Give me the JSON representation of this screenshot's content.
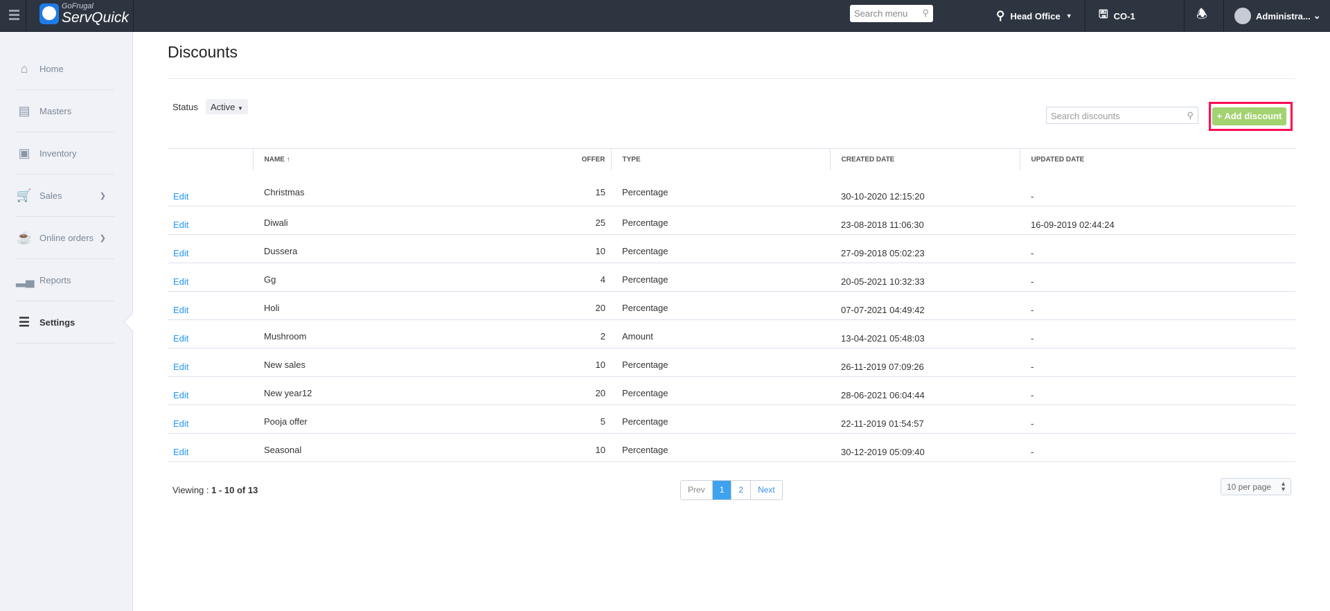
{
  "topbar": {
    "brand_small": "GoFrugal",
    "brand": "ServQuick",
    "search_placeholder": "Search menu",
    "location": "Head Office",
    "counter": "CO-1",
    "user": "Administra..."
  },
  "sidebar": {
    "items": [
      {
        "label": "Home",
        "icon": "home-icon"
      },
      {
        "label": "Masters",
        "icon": "masters-icon"
      },
      {
        "label": "Inventory",
        "icon": "inventory-icon"
      },
      {
        "label": "Sales",
        "icon": "cart-icon"
      },
      {
        "label": "Online orders",
        "icon": "online-orders-icon"
      },
      {
        "label": "Reports",
        "icon": "reports-icon"
      },
      {
        "label": "Settings",
        "icon": "settings-icon"
      }
    ]
  },
  "page": {
    "title": "Discounts",
    "status_label": "Status",
    "status_value": "Active",
    "search_placeholder": "Search discounts",
    "add_label": "+ Add discount"
  },
  "table": {
    "headers": {
      "name": "NAME",
      "offer": "OFFER",
      "type": "TYPE",
      "created": "CREATED DATE",
      "updated": "UPDATED DATE"
    },
    "edit_label": "Edit",
    "rows": [
      {
        "name": "Christmas",
        "offer": "15",
        "type": "Percentage",
        "created": "30-10-2020 12:15:20",
        "updated": "-"
      },
      {
        "name": "Diwali",
        "offer": "25",
        "type": "Percentage",
        "created": "23-08-2018 11:06:30",
        "updated": "16-09-2019 02:44:24"
      },
      {
        "name": "Dussera",
        "offer": "10",
        "type": "Percentage",
        "created": "27-09-2018 05:02:23",
        "updated": "-"
      },
      {
        "name": "Gg",
        "offer": "4",
        "type": "Percentage",
        "created": "20-05-2021 10:32:33",
        "updated": "-"
      },
      {
        "name": "Holi",
        "offer": "20",
        "type": "Percentage",
        "created": "07-07-2021 04:49:42",
        "updated": "-"
      },
      {
        "name": "Mushroom",
        "offer": "2",
        "type": "Amount",
        "created": "13-04-2021 05:48:03",
        "updated": "-"
      },
      {
        "name": "New sales",
        "offer": "10",
        "type": "Percentage",
        "created": "26-11-2019 07:09:26",
        "updated": "-"
      },
      {
        "name": "New year12",
        "offer": "20",
        "type": "Percentage",
        "created": "28-06-2021 06:04:44",
        "updated": "-"
      },
      {
        "name": "Pooja offer",
        "offer": "5",
        "type": "Percentage",
        "created": "22-11-2019 01:54:57",
        "updated": "-"
      },
      {
        "name": "Seasonal",
        "offer": "10",
        "type": "Percentage",
        "created": "30-12-2019 05:09:40",
        "updated": "-"
      }
    ]
  },
  "footer": {
    "viewing_label": "Viewing : ",
    "viewing_range": "1 - 10 of 13",
    "prev": "Prev",
    "pages": [
      "1",
      "2"
    ],
    "next": "Next",
    "per_page": "10 per page"
  }
}
